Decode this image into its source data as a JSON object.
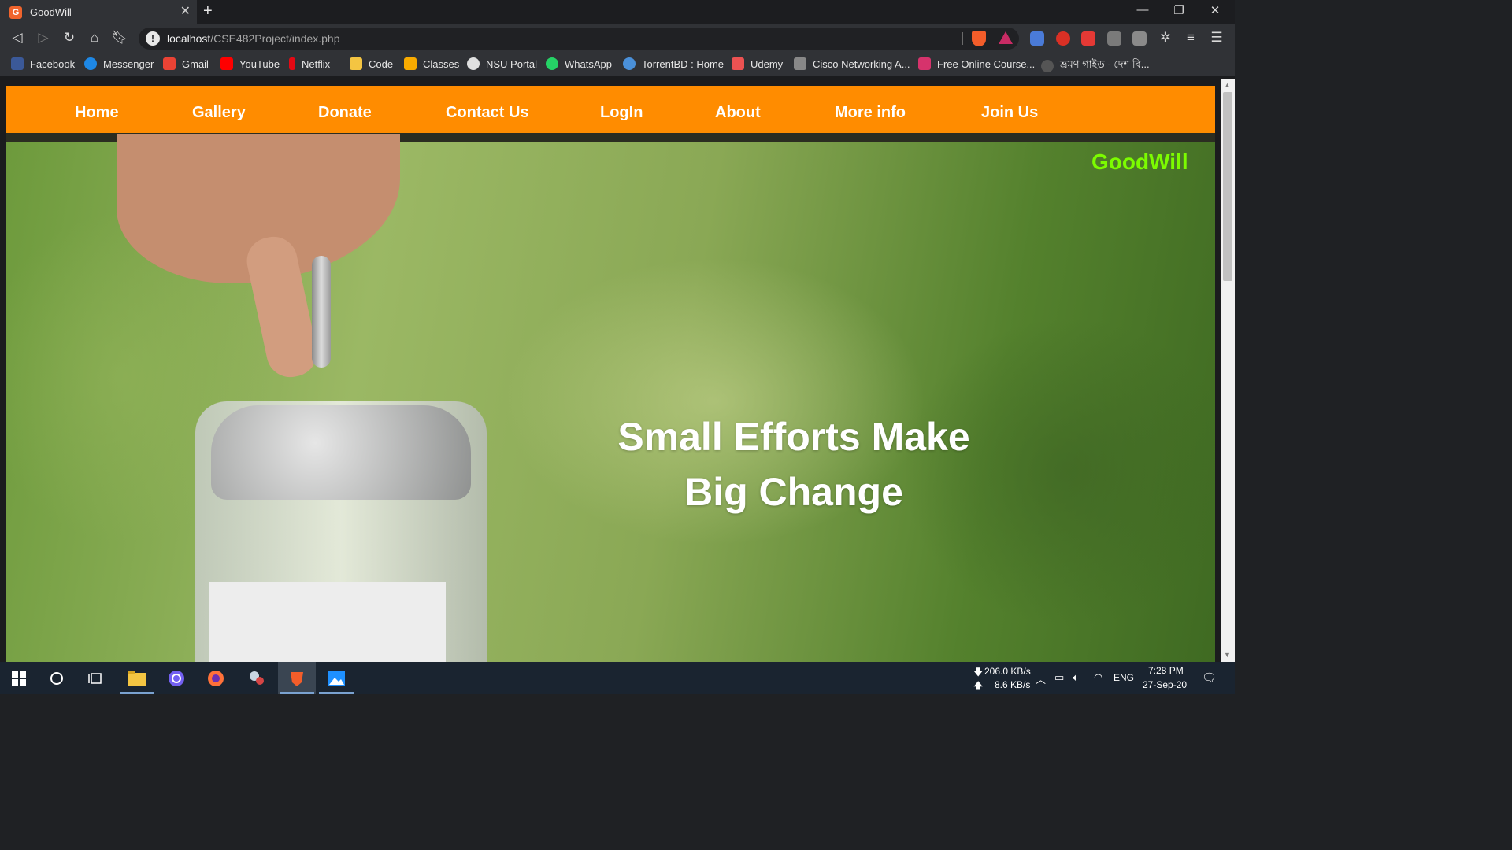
{
  "browser": {
    "tab_title": "GoodWill",
    "tab_favicon_letter": "G",
    "new_tab_symbol": "+",
    "url_host": "localhost",
    "url_path": "/CSE482Project/index.php",
    "bookmarks": [
      {
        "label": "Facebook",
        "color": "#3b5998"
      },
      {
        "label": "Messenger",
        "color": "#1e88e5"
      },
      {
        "label": "Gmail",
        "color": "#ea4335"
      },
      {
        "label": "YouTube",
        "color": "#ff0000"
      },
      {
        "label": "Netflix",
        "color": "#e50914"
      },
      {
        "label": "Code",
        "color": "#f4c542"
      },
      {
        "label": "Classes",
        "color": "#f9ab00"
      },
      {
        "label": "NSU Portal",
        "color": "#e0e0e0"
      },
      {
        "label": "WhatsApp",
        "color": "#25d366"
      },
      {
        "label": "TorrentBD : Home",
        "color": "#4a90d9"
      },
      {
        "label": "Udemy",
        "color": "#ec5252"
      },
      {
        "label": "Cisco Networking A...",
        "color": "#888888"
      },
      {
        "label": "Free Online Course...",
        "color": "#d6336c"
      },
      {
        "label": "ভ্রমণ গাইড - দেশ বি...",
        "color": "#555555"
      }
    ]
  },
  "page": {
    "nav": [
      "Home",
      "Gallery",
      "Donate",
      "Contact Us",
      "LogIn",
      "About",
      "More info",
      "Join Us"
    ],
    "brand": "GoodWill",
    "headline_line1": "Small Efforts Make",
    "headline_line2": "Big Change",
    "colors": {
      "nav_bg": "#ff8c00",
      "brand": "#7cfc00",
      "headline": "#ffffff"
    }
  },
  "taskbar": {
    "net_down": "206.0 KB/s",
    "net_up": "8.6 KB/s",
    "language": "ENG",
    "time": "7:28 PM",
    "date": "27-Sep-20"
  }
}
